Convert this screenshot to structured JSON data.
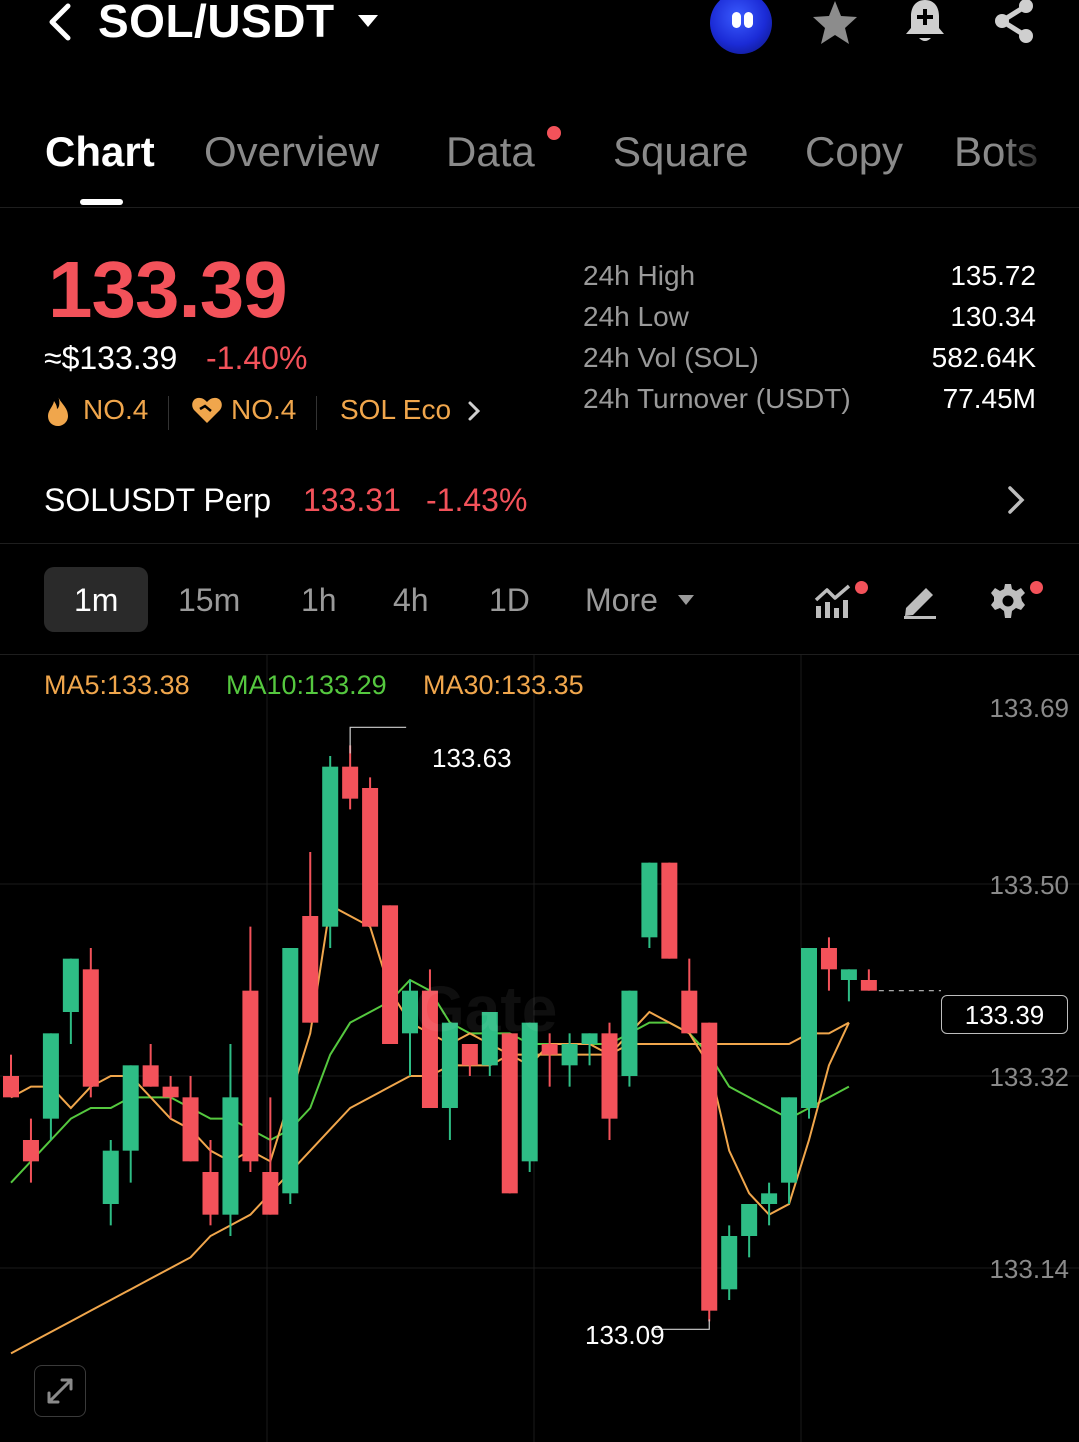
{
  "header": {
    "pair": "SOL/USDT"
  },
  "tabs": [
    {
      "label": "Chart",
      "active": true
    },
    {
      "label": "Overview"
    },
    {
      "label": "Data"
    },
    {
      "label": "Square"
    },
    {
      "label": "Copy"
    },
    {
      "label": "Bots"
    }
  ],
  "ticker": {
    "price": "133.39",
    "usd_price": "≈$133.39",
    "change_pct": "-1.40%",
    "ranks": [
      "NO.4",
      "NO.4"
    ],
    "eco_label": "SOL Eco",
    "stats": [
      {
        "label": "24h High",
        "value": "135.72"
      },
      {
        "label": "24h Low",
        "value": "130.34"
      },
      {
        "label": "24h Vol (SOL)",
        "value": "582.64K"
      },
      {
        "label": "24h Turnover (USDT)",
        "value": "77.45M"
      }
    ]
  },
  "perp": {
    "name": "SOLUSDT Perp",
    "price": "133.31",
    "change_pct": "-1.43%"
  },
  "intervals": {
    "items": [
      "1m",
      "15m",
      "1h",
      "4h",
      "1D"
    ],
    "active": "1m",
    "more_label": "More"
  },
  "colors": {
    "up": "#2ebd85",
    "down": "#f3525a",
    "ma5": "#f0a64c",
    "ma10": "#55c83f",
    "ma30": "#f0a64c"
  },
  "chart_data": {
    "type": "candlestick",
    "ma": {
      "ma5": "MA5:133.38",
      "ma10": "MA10:133.29",
      "ma30": "MA30:133.35"
    },
    "y_ticks": [
      "133.69",
      "133.50",
      "133.32",
      "133.14"
    ],
    "ylim": [
      133.0,
      133.74
    ],
    "last_price": "133.39",
    "high_annotation": "133.63",
    "low_annotation": "133.09",
    "watermark": "Gate",
    "candles": [
      {
        "o": 133.32,
        "h": 133.34,
        "l": 133.3,
        "c": 133.3
      },
      {
        "o": 133.26,
        "h": 133.28,
        "l": 133.22,
        "c": 133.24
      },
      {
        "o": 133.28,
        "h": 133.36,
        "l": 133.26,
        "c": 133.36
      },
      {
        "o": 133.38,
        "h": 133.42,
        "l": 133.35,
        "c": 133.43
      },
      {
        "o": 133.42,
        "h": 133.44,
        "l": 133.3,
        "c": 133.31
      },
      {
        "o": 133.2,
        "h": 133.26,
        "l": 133.18,
        "c": 133.25
      },
      {
        "o": 133.25,
        "h": 133.33,
        "l": 133.22,
        "c": 133.33
      },
      {
        "o": 133.33,
        "h": 133.35,
        "l": 133.31,
        "c": 133.31
      },
      {
        "o": 133.31,
        "h": 133.32,
        "l": 133.28,
        "c": 133.3
      },
      {
        "o": 133.3,
        "h": 133.32,
        "l": 133.26,
        "c": 133.24
      },
      {
        "o": 133.23,
        "h": 133.26,
        "l": 133.18,
        "c": 133.19
      },
      {
        "o": 133.19,
        "h": 133.35,
        "l": 133.17,
        "c": 133.3
      },
      {
        "o": 133.4,
        "h": 133.46,
        "l": 133.23,
        "c": 133.24
      },
      {
        "o": 133.23,
        "h": 133.3,
        "l": 133.19,
        "c": 133.19
      },
      {
        "o": 133.21,
        "h": 133.38,
        "l": 133.2,
        "c": 133.44
      },
      {
        "o": 133.47,
        "h": 133.53,
        "l": 133.37,
        "c": 133.37
      },
      {
        "o": 133.46,
        "h": 133.62,
        "l": 133.44,
        "c": 133.61
      },
      {
        "o": 133.61,
        "h": 133.63,
        "l": 133.57,
        "c": 133.58
      },
      {
        "o": 133.59,
        "h": 133.6,
        "l": 133.46,
        "c": 133.46
      },
      {
        "o": 133.48,
        "h": 133.48,
        "l": 133.35,
        "c": 133.35
      },
      {
        "o": 133.36,
        "h": 133.41,
        "l": 133.32,
        "c": 133.4
      },
      {
        "o": 133.4,
        "h": 133.42,
        "l": 133.29,
        "c": 133.29
      },
      {
        "o": 133.29,
        "h": 133.35,
        "l": 133.26,
        "c": 133.37
      },
      {
        "o": 133.35,
        "h": 133.35,
        "l": 133.32,
        "c": 133.33
      },
      {
        "o": 133.33,
        "h": 133.37,
        "l": 133.32,
        "c": 133.38
      },
      {
        "o": 133.36,
        "h": 133.36,
        "l": 133.21,
        "c": 133.21
      },
      {
        "o": 133.24,
        "h": 133.37,
        "l": 133.23,
        "c": 133.37
      },
      {
        "o": 133.35,
        "h": 133.36,
        "l": 133.31,
        "c": 133.34
      },
      {
        "o": 133.33,
        "h": 133.36,
        "l": 133.31,
        "c": 133.35
      },
      {
        "o": 133.35,
        "h": 133.36,
        "l": 133.33,
        "c": 133.36
      },
      {
        "o": 133.36,
        "h": 133.37,
        "l": 133.26,
        "c": 133.28
      },
      {
        "o": 133.32,
        "h": 133.4,
        "l": 133.31,
        "c": 133.4
      },
      {
        "o": 133.45,
        "h": 133.52,
        "l": 133.44,
        "c": 133.52
      },
      {
        "o": 133.52,
        "h": 133.51,
        "l": 133.44,
        "c": 133.43
      },
      {
        "o": 133.4,
        "h": 133.43,
        "l": 133.36,
        "c": 133.36
      },
      {
        "o": 133.37,
        "h": 133.37,
        "l": 133.09,
        "c": 133.1
      },
      {
        "o": 133.12,
        "h": 133.18,
        "l": 133.11,
        "c": 133.17
      },
      {
        "o": 133.17,
        "h": 133.2,
        "l": 133.15,
        "c": 133.2
      },
      {
        "o": 133.2,
        "h": 133.22,
        "l": 133.18,
        "c": 133.21
      },
      {
        "o": 133.22,
        "h": 133.3,
        "l": 133.2,
        "c": 133.3
      },
      {
        "o": 133.29,
        "h": 133.44,
        "l": 133.28,
        "c": 133.44
      },
      {
        "o": 133.44,
        "h": 133.45,
        "l": 133.4,
        "c": 133.42
      },
      {
        "o": 133.41,
        "h": 133.42,
        "l": 133.39,
        "c": 133.42
      },
      {
        "o": 133.41,
        "h": 133.42,
        "l": 133.4,
        "c": 133.4
      }
    ],
    "ma5_series": [
      133.3,
      133.31,
      133.31,
      133.29,
      133.31,
      133.32,
      133.32,
      133.3,
      133.28,
      133.27,
      133.25,
      133.24,
      133.25,
      133.24,
      133.3,
      133.36,
      133.48,
      133.47,
      133.46,
      133.4,
      133.37,
      133.36,
      133.35,
      133.36,
      133.35,
      133.34,
      133.33,
      133.35,
      133.35,
      133.35,
      133.34,
      133.36,
      133.38,
      133.37,
      133.36,
      133.33,
      133.25,
      133.21,
      133.19,
      133.2,
      133.26,
      133.33,
      133.37
    ],
    "ma10_series": [
      133.22,
      133.24,
      133.26,
      133.28,
      133.29,
      133.29,
      133.3,
      133.3,
      133.3,
      133.29,
      133.28,
      133.28,
      133.27,
      133.26,
      133.27,
      133.29,
      133.34,
      133.37,
      133.38,
      133.39,
      133.41,
      133.4,
      133.37,
      133.36,
      133.36,
      133.36,
      133.35,
      133.35,
      133.35,
      133.35,
      133.35,
      133.36,
      133.37,
      133.37,
      133.36,
      133.34,
      133.31,
      133.3,
      133.29,
      133.28,
      133.29,
      133.3,
      133.31
    ],
    "ma30_series": [
      133.06,
      133.07,
      133.08,
      133.09,
      133.1,
      133.11,
      133.12,
      133.13,
      133.14,
      133.15,
      133.17,
      133.18,
      133.19,
      133.21,
      133.23,
      133.25,
      133.27,
      133.29,
      133.3,
      133.31,
      133.32,
      133.32,
      133.33,
      133.33,
      133.33,
      133.34,
      133.34,
      133.34,
      133.34,
      133.34,
      133.34,
      133.35,
      133.35,
      133.35,
      133.35,
      133.35,
      133.35,
      133.35,
      133.35,
      133.35,
      133.36,
      133.36,
      133.37
    ]
  }
}
